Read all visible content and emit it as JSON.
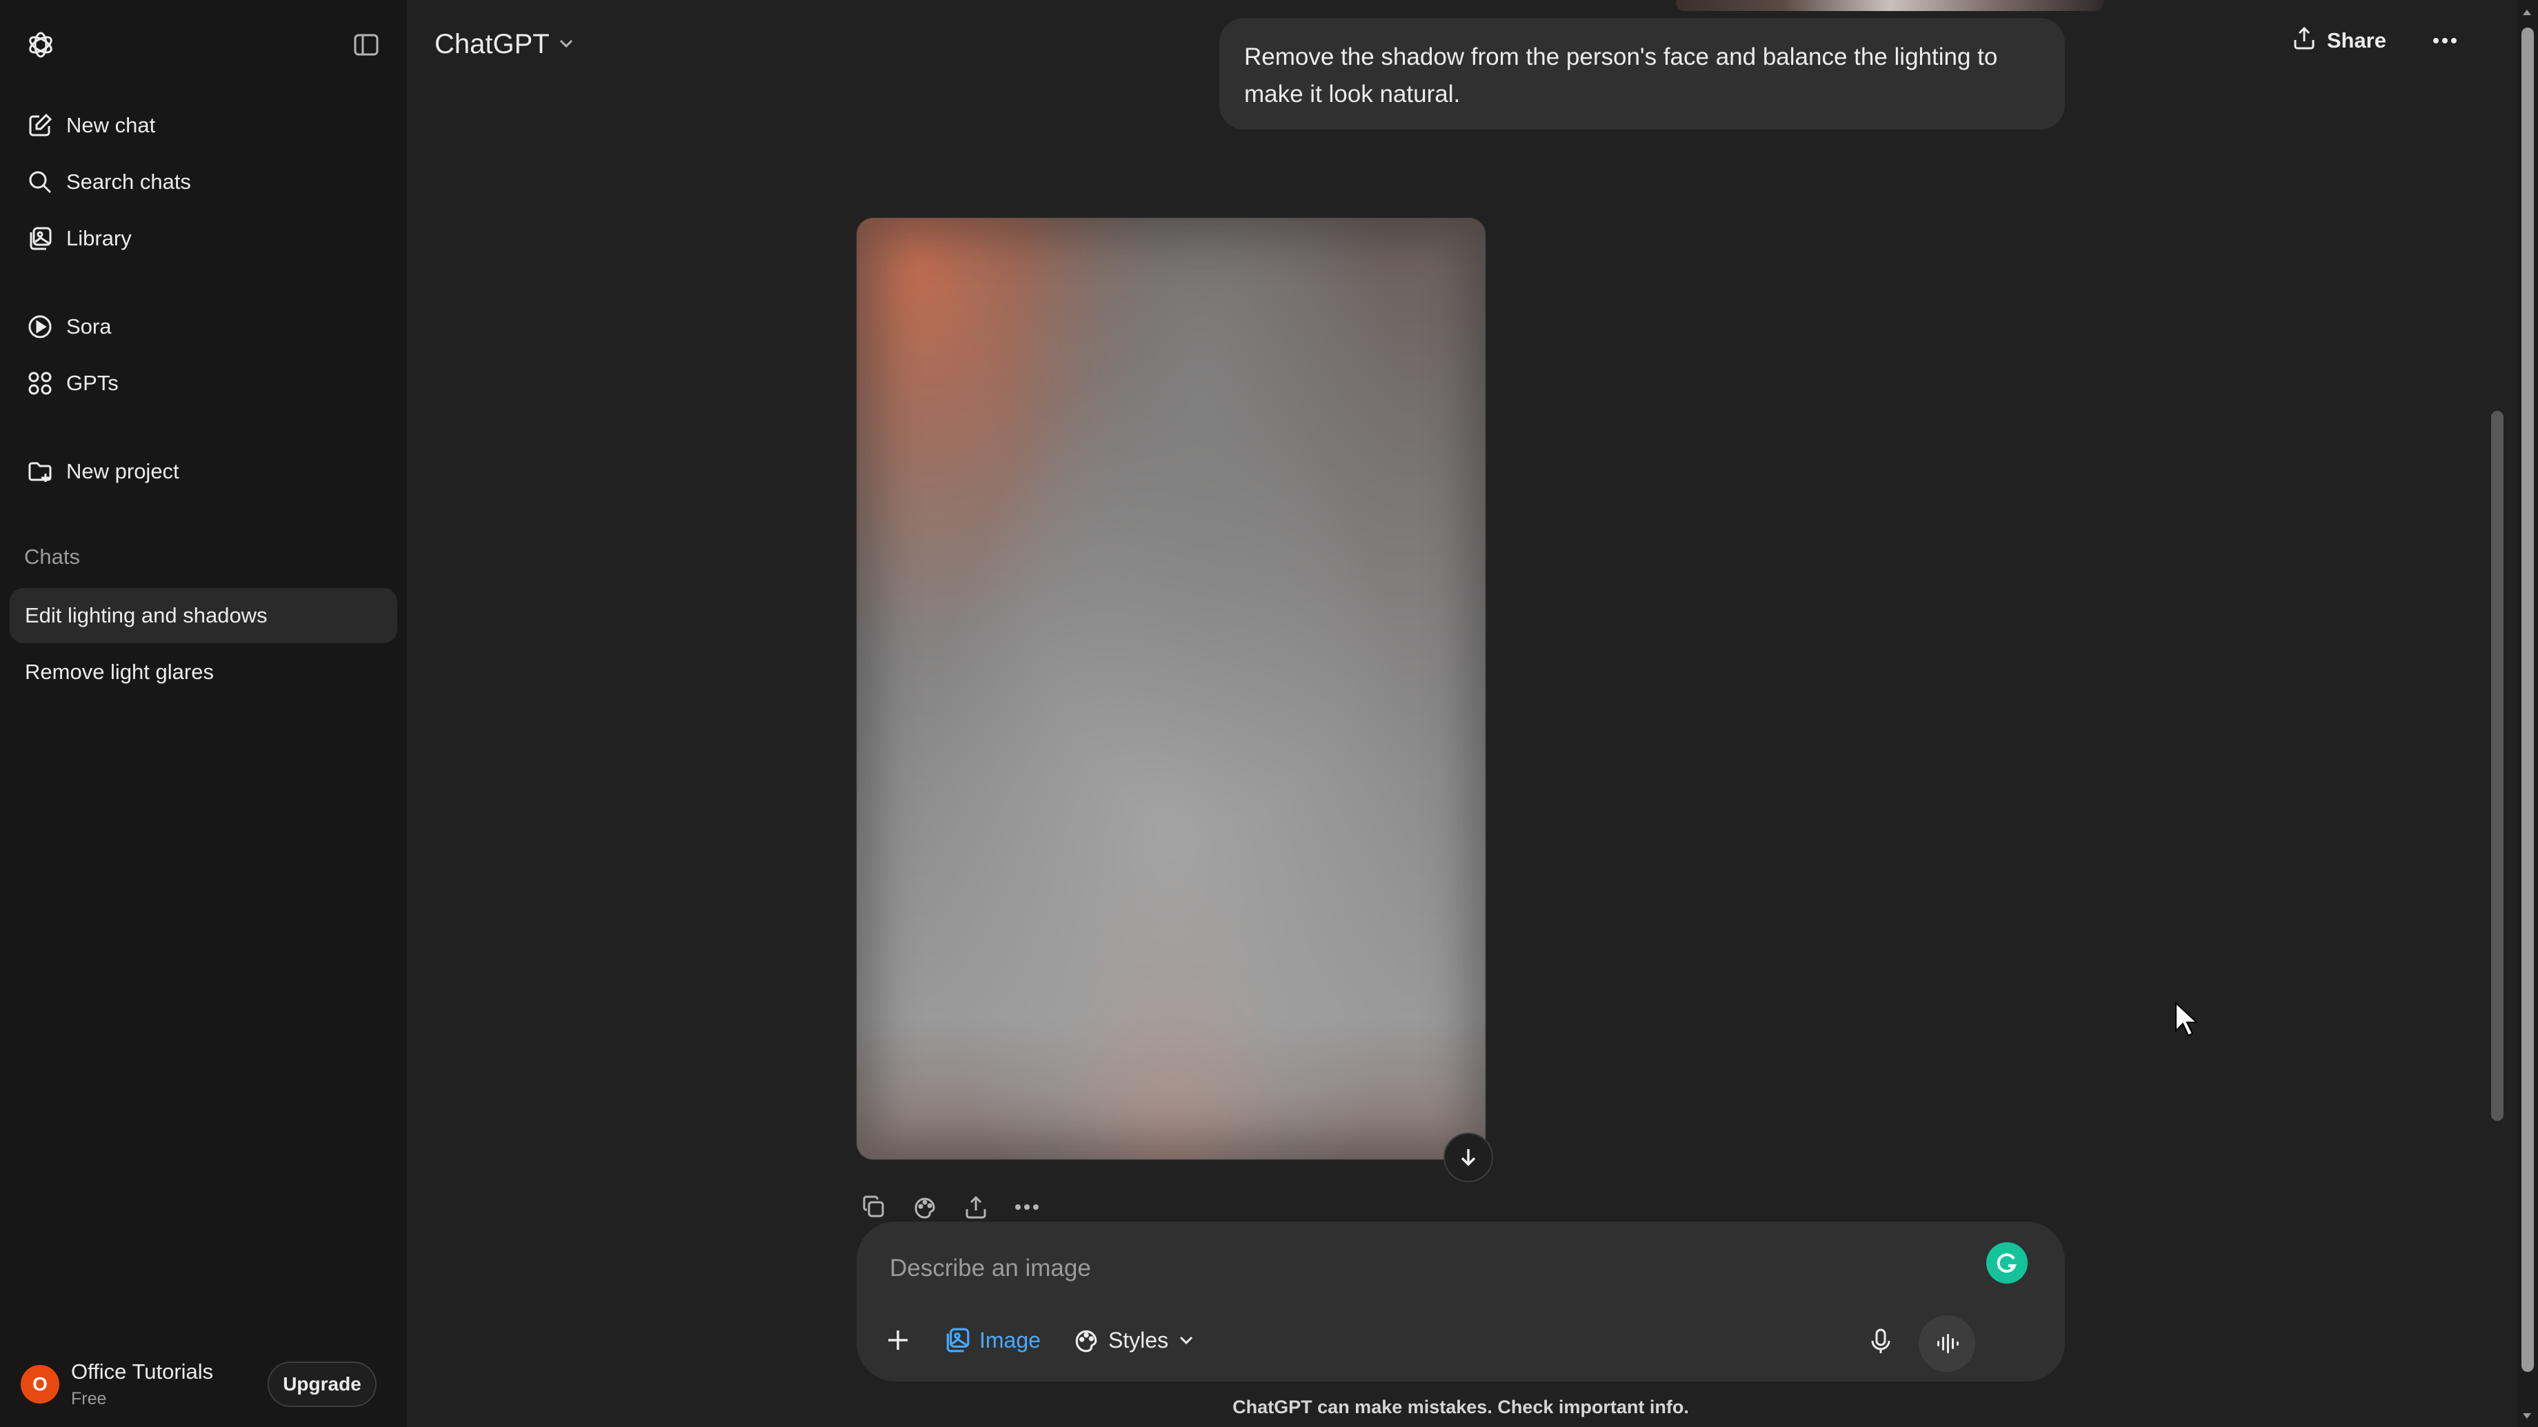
{
  "sidebar": {
    "logo_icon": "openai-logo-icon",
    "nav": [
      {
        "label": "New chat",
        "icon": "compose-icon"
      },
      {
        "label": "Search chats",
        "icon": "search-icon"
      },
      {
        "label": "Library",
        "icon": "library-icon"
      },
      {
        "label": "Sora",
        "icon": "play-circle-icon"
      },
      {
        "label": "GPTs",
        "icon": "grid-icon"
      },
      {
        "label": "New project",
        "icon": "folder-plus-icon"
      }
    ],
    "chats_section_label": "Chats",
    "chats": [
      {
        "label": "Edit lighting and shadows",
        "active": true
      },
      {
        "label": "Remove light glares",
        "active": false
      }
    ],
    "user": {
      "initial": "O",
      "name": "Office Tutorials",
      "plan": "Free",
      "upgrade_label": "Upgrade",
      "avatar_color": "#e8490f"
    }
  },
  "header": {
    "model_name": "ChatGPT",
    "share_label": "Share"
  },
  "conversation": {
    "user_message": "Remove the shadow from the person's face and balance the lighting to make it look natural."
  },
  "composer": {
    "placeholder": "Describe an image",
    "image_tool_label": "Image",
    "styles_tool_label": "Styles"
  },
  "footer": {
    "disclaimer": "ChatGPT can make mistakes. Check important info."
  },
  "colors": {
    "sidebar_bg": "#171717",
    "main_bg": "#212121",
    "bubble_bg": "#303030",
    "accent_image": "#48aaff",
    "grammarly": "#15c39a"
  }
}
